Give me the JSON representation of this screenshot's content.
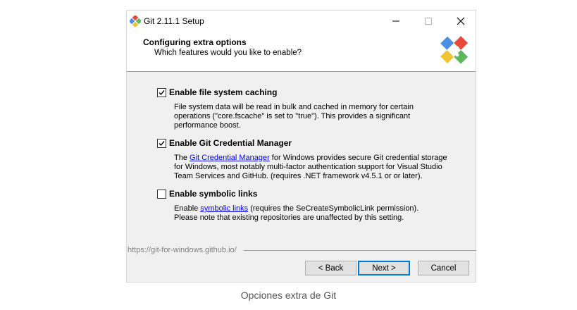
{
  "window": {
    "title": "Git 2.11.1 Setup",
    "minimize_icon": "minimize-icon",
    "maximize_icon": "maximize-icon",
    "close_icon": "close-icon"
  },
  "header": {
    "title": "Configuring extra options",
    "subtitle": "Which features would you like to enable?",
    "logo_icon": "git-logo-icon"
  },
  "options": [
    {
      "label": "Enable file system caching",
      "checked": true,
      "desc_lines": [
        "File system data will be read in bulk and cached in memory for certain",
        "operations (\"core.fscache\" is set to \"true\"). This provides a significant",
        "performance boost."
      ]
    },
    {
      "label": "Enable Git Credential Manager",
      "checked": true,
      "desc_prefix": "The ",
      "desc_link": "Git Credential Manager",
      "desc_suffix": " for Windows provides secure Git credential storage",
      "desc_lines": [
        "for Windows, most notably multi-factor authentication support for Visual Studio",
        "Team Services and GitHub. (requires .NET framework v4.5.1 or or later)."
      ]
    },
    {
      "label": "Enable symbolic links",
      "checked": false,
      "desc_prefix": "Enable ",
      "desc_link": "symbolic links",
      "desc_suffix": " (requires the SeCreateSymbolicLink permission).",
      "desc_lines": [
        "Please note that existing repositories are unaffected by this setting."
      ]
    }
  ],
  "footer": {
    "url": "https://git-for-windows.github.io/",
    "back_label": "< Back",
    "next_label": "Next >",
    "cancel_label": "Cancel"
  },
  "caption": "Opciones extra de Git",
  "colors": {
    "link": "#0000ee",
    "accent": "#0078d7",
    "window_bg": "#f0f0f0"
  }
}
